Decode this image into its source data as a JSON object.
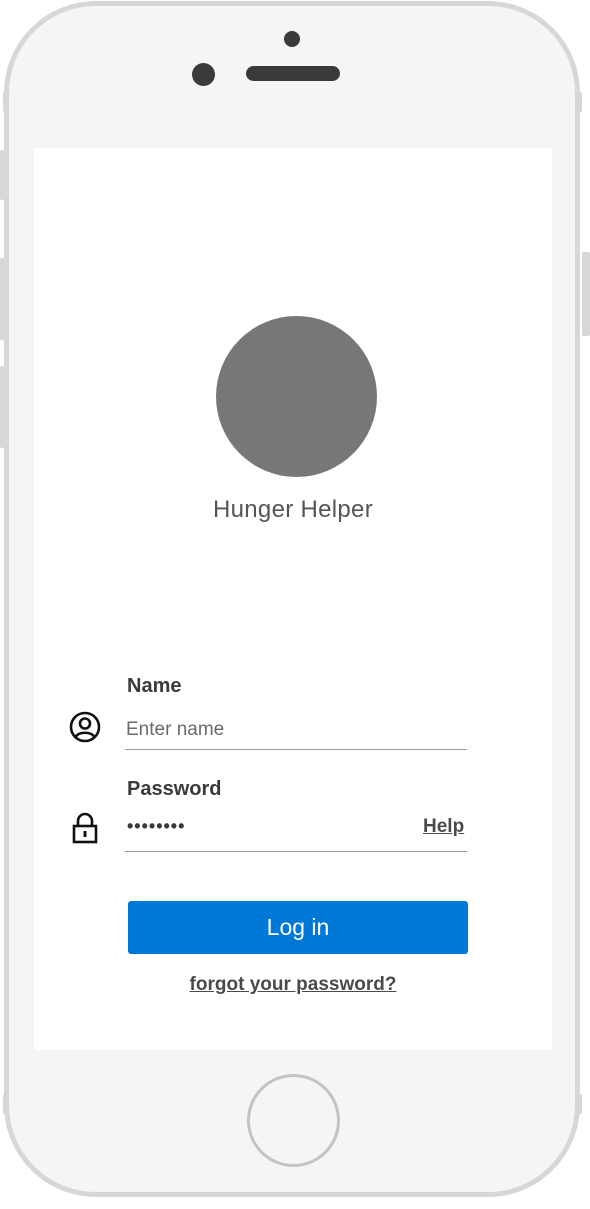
{
  "app": {
    "name": "Hunger Helper"
  },
  "login_form": {
    "name_label": "Name",
    "name_placeholder": "Enter name",
    "name_value": "",
    "password_label": "Password",
    "password_masked_value": "••••••••",
    "help_link": "Help",
    "login_button": "Log in",
    "forgot_password_link": "forgot your password?"
  },
  "icons": {
    "name_field": "user-circle-icon",
    "password_field": "lock-icon"
  },
  "colors": {
    "primary_button": "#0078d7",
    "logo_placeholder": "#777777",
    "device_frame": "#d7d7da"
  }
}
